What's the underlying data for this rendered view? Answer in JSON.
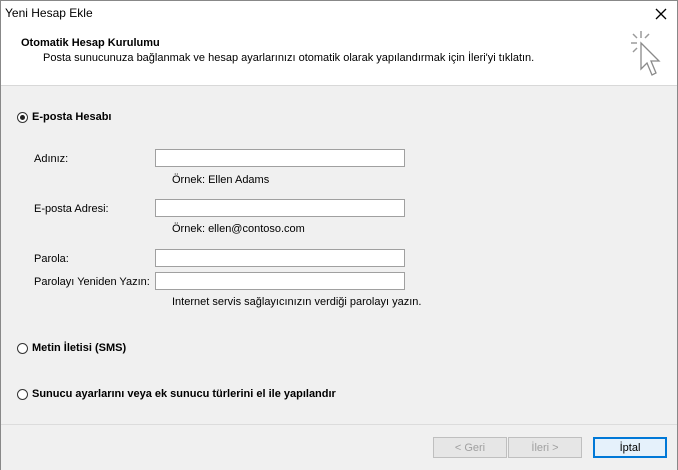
{
  "window": {
    "title": "Yeni Hesap Ekle"
  },
  "header": {
    "title": "Otomatik Hesap Kurulumu",
    "subtitle": "Posta sunucunuza bağlanmak ve hesap ayarlarınızı otomatik olarak yapılandırmak için İleri'yi tıklatın."
  },
  "options": {
    "email_account": {
      "label": "E-posta Hesabı",
      "selected": true
    },
    "sms": {
      "label": "Metin İletisi (SMS)",
      "selected": false
    },
    "manual": {
      "label": "Sunucu ayarlarını veya ek sunucu türlerini el ile yapılandır",
      "selected": false
    }
  },
  "form": {
    "name_label": "Adınız:",
    "name_value": "",
    "name_hint": "Örnek: Ellen Adams",
    "email_label": "E-posta Adresi:",
    "email_value": "",
    "email_hint": "Örnek: ellen@contoso.com",
    "password_label": "Parola:",
    "password_value": "",
    "password_confirm_label": "Parolayı Yeniden Yazın:",
    "password_confirm_value": "",
    "password_hint": "Internet servis sağlayıcınızın verdiği parolayı yazın."
  },
  "footer": {
    "back_label": "< Geri",
    "next_label": "İleri >",
    "cancel_label": "İptal"
  },
  "icons": {
    "close": "close-icon",
    "wizard": "cursor-sparkle-icon"
  }
}
